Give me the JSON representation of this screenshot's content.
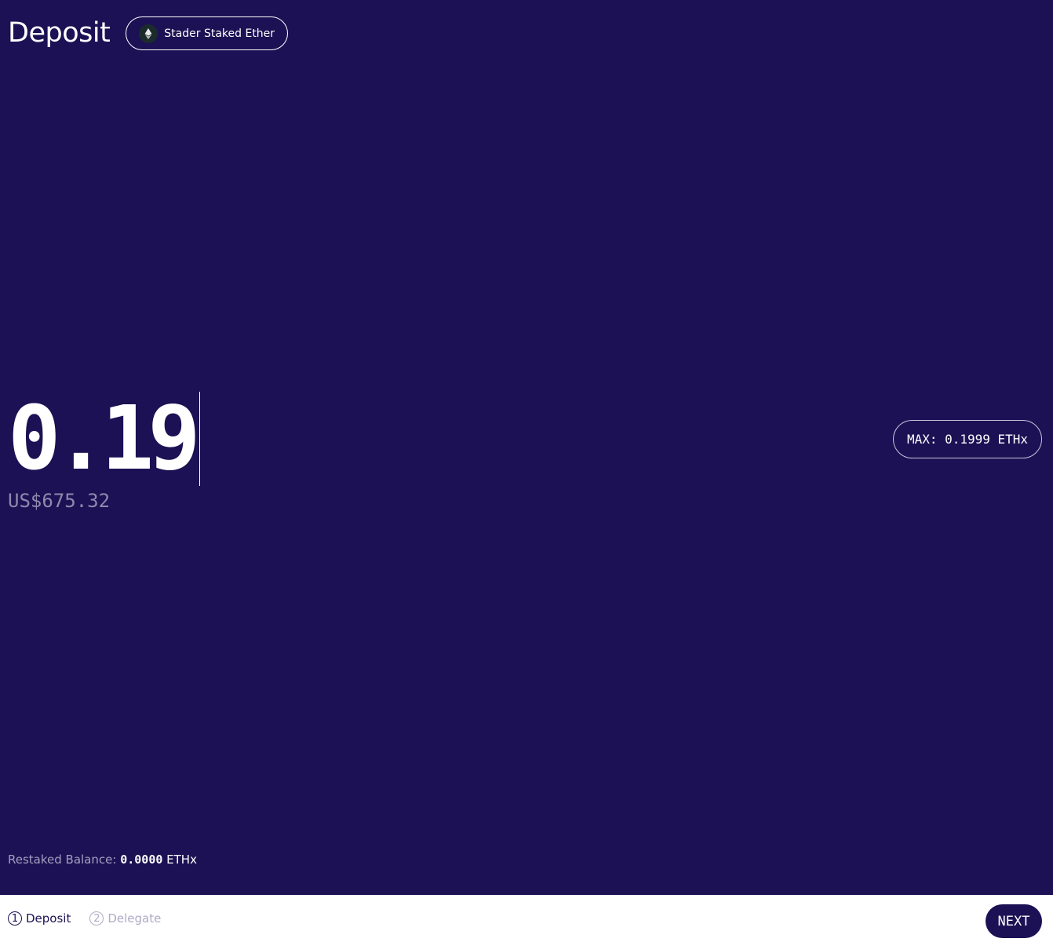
{
  "header": {
    "title": "Deposit",
    "token_name": "Stader Staked Ether",
    "token_icon": "ethereum-icon"
  },
  "amount": {
    "value": "0.19",
    "usd_value": "US$675.32"
  },
  "max_button": {
    "label": "MAX: 0.1999 ETHx"
  },
  "balance": {
    "label": "Restaked Balance:",
    "value": "0.0000",
    "unit": "ETHx"
  },
  "footer": {
    "steps": [
      {
        "num": "1",
        "label": "Deposit",
        "state": "active"
      },
      {
        "num": "2",
        "label": "Delegate",
        "state": "inactive"
      }
    ],
    "next_label": "NEXT"
  },
  "colors": {
    "background": "#1c1154",
    "footer_background": "#ffffff",
    "muted_text": "#8f89ad"
  }
}
